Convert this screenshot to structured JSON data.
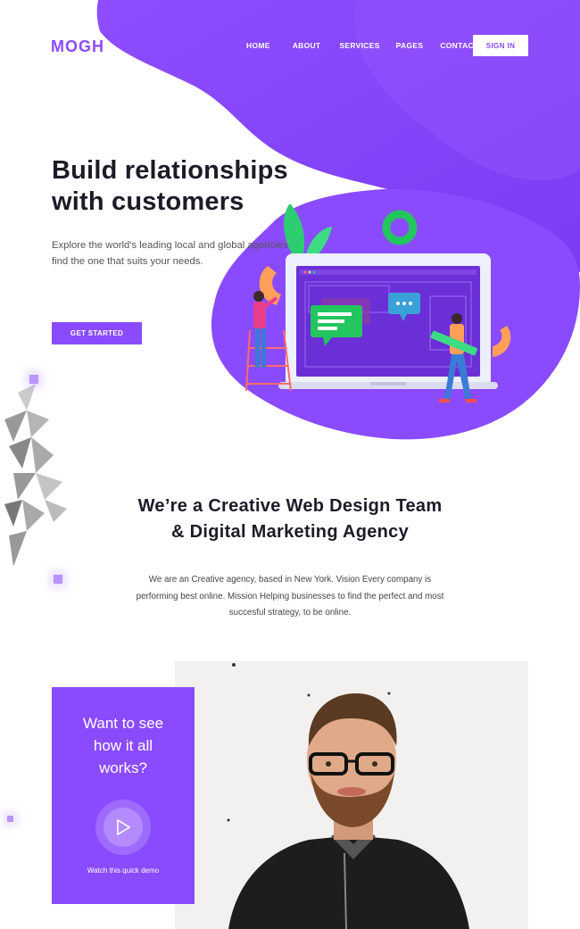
{
  "brand": {
    "logo": "MOGH",
    "accent": "#8a4bff"
  },
  "nav": {
    "items": [
      {
        "label": "HOME"
      },
      {
        "label": "ABOUT"
      },
      {
        "label": "SERVICES"
      },
      {
        "label": "PAGES"
      },
      {
        "label": "CONTACT"
      }
    ],
    "signin_label": "SIGN IN"
  },
  "hero": {
    "title_line1": "Build relationships",
    "title_line2": "with customers",
    "subtitle_line1": "Explore the world's leading local and global agencies to",
    "subtitle_line2": "find the one that suits your needs.",
    "cta_label": "GET STARTED"
  },
  "intro": {
    "title_line1": "We’re a Creative Web Design Team",
    "title_line2": "& Digital Marketing Agency",
    "text_line1": "We are an Creative agency, based in New York. Vision Every company is",
    "text_line2": "performing best online. Mission Helping businesses to find the perfect and most",
    "text_line3": "succesful strategy, to be online."
  },
  "promo": {
    "title_line1": "Want to see",
    "title_line2": "how it all",
    "title_line3": "works?",
    "caption": "Watch this quick demo",
    "play_icon": "play-icon"
  }
}
